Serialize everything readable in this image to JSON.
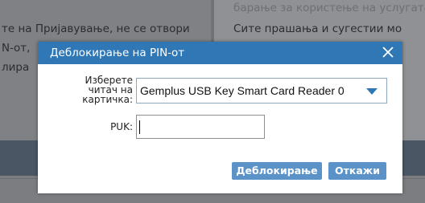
{
  "background": {
    "left_lines": [
      "те на Пријавување, не се отвори",
      "N-от,",
      "лира"
    ],
    "right_lines": [
      "барање за користење на услугата",
      "Сите прашања и сугестии мо"
    ]
  },
  "dialog": {
    "title": "Деблокирање на PIN-от",
    "reader_label": "Изберете\nчитач на\nкартичка:",
    "reader_selected": "Gemplus USB Key Smart Card Reader 0",
    "puk_label": "PUK:",
    "puk_value": "",
    "unblock_button": "Деблокирање",
    "cancel_button": "Откажи"
  },
  "colors": {
    "titlebar": "#2f77b5",
    "button": "#5b93c8",
    "overlay": "#7f8184"
  },
  "icons": {
    "close": "close-icon",
    "dropdown": "chevron-down-icon"
  }
}
